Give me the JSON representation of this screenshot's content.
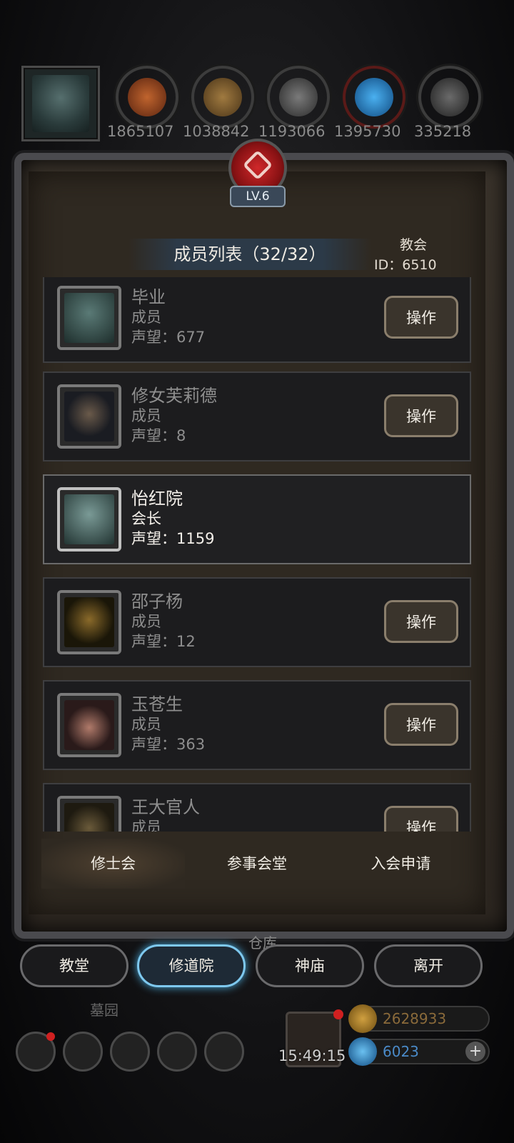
{
  "resources": {
    "values": [
      "1865107",
      "1038842",
      "1193066",
      "1395730",
      "335218"
    ],
    "colors": [
      "#a0522d",
      "#8a6a3a",
      "#6a6a6a",
      "#2a8ad0",
      "#5a5a5a"
    ]
  },
  "guild": {
    "level": "LV.6",
    "list_title": "成员列表（32/32）",
    "label": "教会",
    "id": "ID：6510"
  },
  "members": [
    {
      "name": "毕业",
      "role": "成员",
      "reputation": "声望：677",
      "action": "操作",
      "leader": false,
      "avatar_color": "#3a5552"
    },
    {
      "name": "修女芙莉德",
      "role": "成员",
      "reputation": "声望：8",
      "action": "操作",
      "leader": false,
      "avatar_color": "#2a3038"
    },
    {
      "name": "怡红院",
      "role": "会长",
      "reputation": "声望：1159",
      "action": "",
      "leader": true,
      "avatar_color": "#4a6a68"
    },
    {
      "name": "邵子杨",
      "role": "成员",
      "reputation": "声望：12",
      "action": "操作",
      "leader": false,
      "avatar_color": "#4a3a1a"
    },
    {
      "name": "玉苍生",
      "role": "成员",
      "reputation": "声望：363",
      "action": "操作",
      "leader": false,
      "avatar_color": "#3a2a2a"
    },
    {
      "name": "王大官人",
      "role": "成员",
      "reputation": "",
      "action": "操作",
      "leader": false,
      "avatar_color": "#4a3a20"
    }
  ],
  "subtabs": {
    "monks": "修士会",
    "council": "参事会堂",
    "applications": "入会申请"
  },
  "map_labels": {
    "warehouse": "仓库",
    "graveyard": "墓园"
  },
  "nav": {
    "church": "教堂",
    "monastery": "修道院",
    "temple": "神庙",
    "leave": "离开"
  },
  "timer": "15:49:15",
  "currency": {
    "gold": "2628933",
    "gems": "6023",
    "plus": "+"
  },
  "colors": {
    "gold_text": "#8a6a3a",
    "gem_text": "#4a8ac8",
    "accent_blue": "#7ec8ee"
  },
  "icons": [
    "settings-icon",
    "compass-icon",
    "book-icon",
    "mail-icon",
    "cube-icon",
    "gift-icon"
  ]
}
